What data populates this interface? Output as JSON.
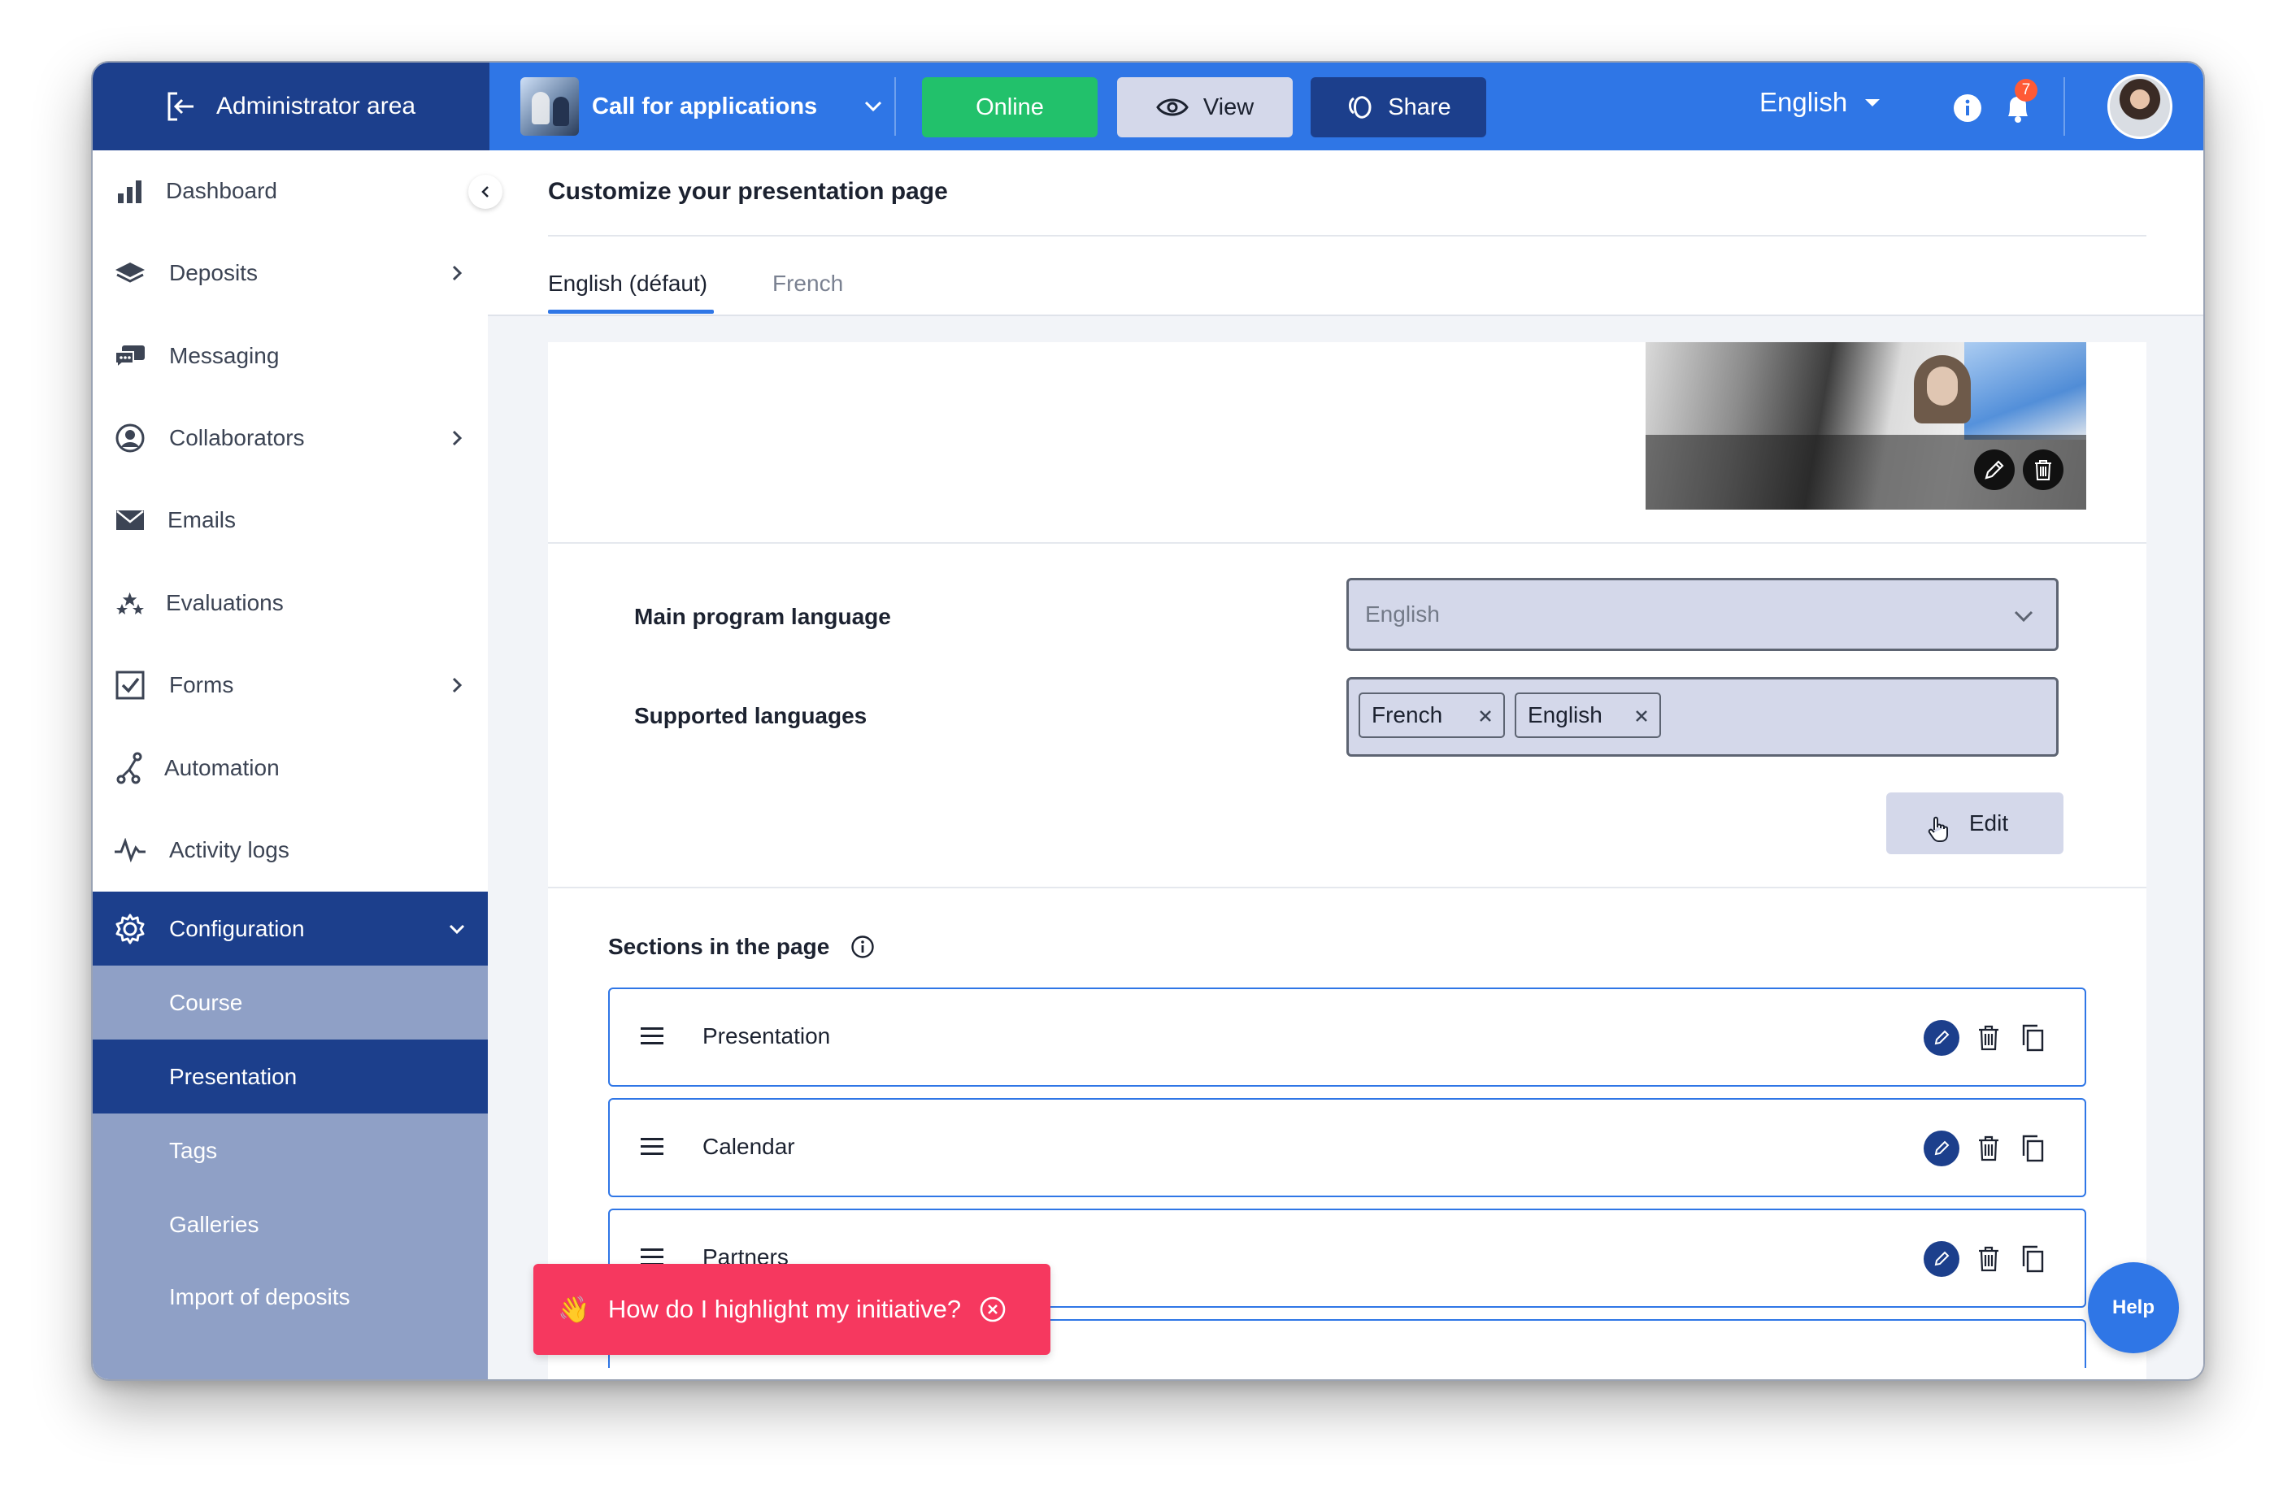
{
  "topbar": {
    "admin_area_label": "Administrator area",
    "program_name": "Call for applications",
    "online_label": "Online",
    "view_label": "View",
    "share_label": "Share",
    "language": "English",
    "notification_count": "7",
    "colors": {
      "primary": "#2f76e6",
      "dark": "#1c3f8c",
      "online": "#22c16b"
    }
  },
  "sidebar": {
    "items": [
      {
        "label": "Dashboard",
        "icon": "bar-chart-icon"
      },
      {
        "label": "Deposits",
        "icon": "layers-icon"
      },
      {
        "label": "Messaging",
        "icon": "chat-icon"
      },
      {
        "label": "Collaborators",
        "icon": "user-circle-icon"
      },
      {
        "label": "Emails",
        "icon": "envelope-icon"
      },
      {
        "label": "Evaluations",
        "icon": "stars-icon"
      },
      {
        "label": "Forms",
        "icon": "checkbox-icon"
      },
      {
        "label": "Automation",
        "icon": "automation-icon"
      },
      {
        "label": "Activity logs",
        "icon": "activity-icon"
      },
      {
        "label": "Configuration",
        "icon": "gear-icon"
      }
    ],
    "subitems": [
      {
        "label": "Course"
      },
      {
        "label": "Presentation"
      },
      {
        "label": "Tags"
      },
      {
        "label": "Galleries"
      },
      {
        "label": "Import of deposits"
      }
    ]
  },
  "main": {
    "title": "Customize your presentation page",
    "tabs": [
      {
        "label": "English (défaut)"
      },
      {
        "label": "French"
      }
    ],
    "language_card": {
      "main_language_label": "Main program language",
      "main_language_value": "English",
      "supported_label": "Supported languages",
      "supported": [
        "French",
        "English"
      ],
      "edit_label": "Edit"
    },
    "sections": {
      "title": "Sections in the page",
      "rows": [
        {
          "name": "Presentation"
        },
        {
          "name": "Calendar"
        },
        {
          "name": "Partners"
        }
      ]
    }
  },
  "toast": {
    "emoji": "👋",
    "text": "How do I highlight my initiative?"
  },
  "help_label": "Help"
}
